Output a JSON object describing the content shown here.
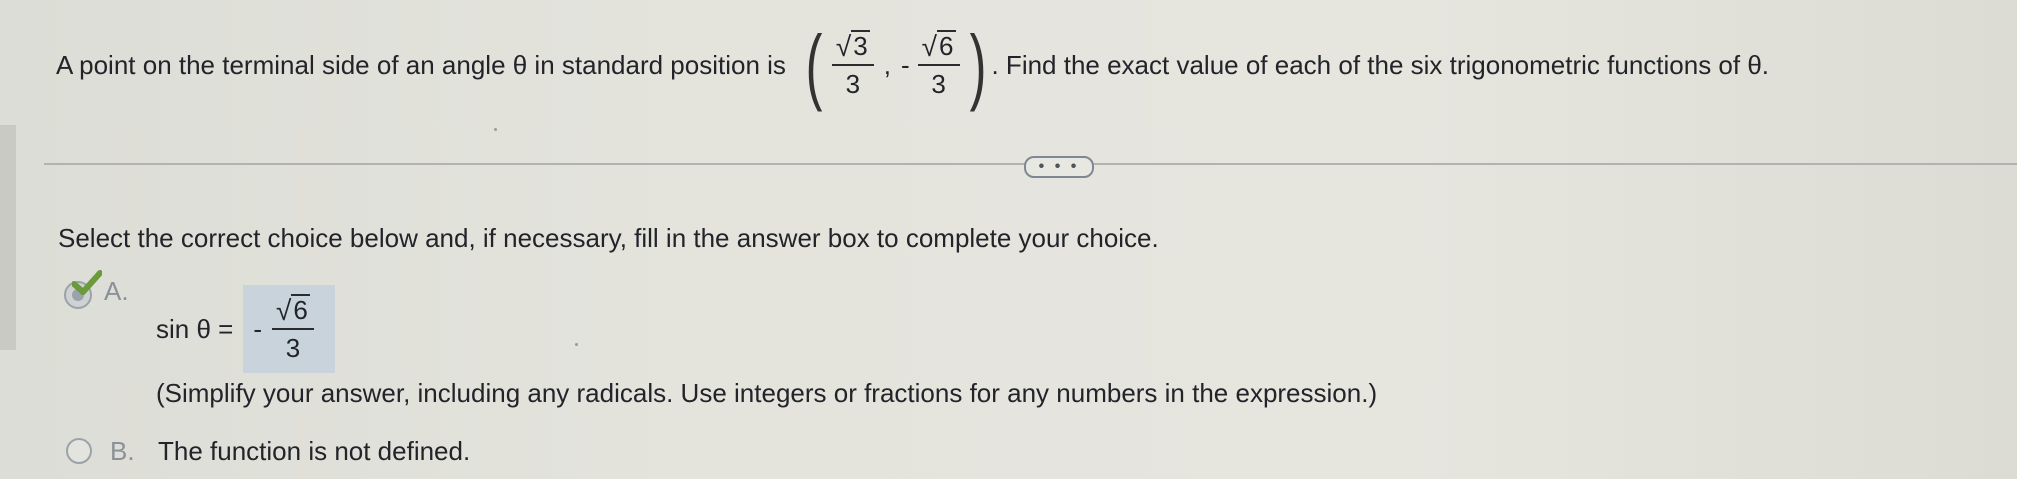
{
  "question": {
    "text_before": "A point on the terminal side of an angle θ in standard position is",
    "point": {
      "x_numerator_radicand": "3",
      "x_denominator": "3",
      "comma": ",",
      "y_sign": "-",
      "y_numerator_radicand": "6",
      "y_denominator": "3"
    },
    "text_after": ". Find the exact value of each of the six trigonometric functions of θ."
  },
  "more_button": {
    "label": "• • •"
  },
  "instruction": "Select the correct choice below and, if necessary, fill in the answer box to complete your choice.",
  "choices": {
    "a": {
      "letter": "A.",
      "selected": true,
      "lhs": "sin θ =",
      "answer": {
        "sign": "-",
        "numerator_radicand": "6",
        "denominator": "3"
      },
      "hint": "(Simplify your answer, including any radicals. Use integers or fractions for any numbers in the expression.)"
    },
    "b": {
      "letter": "B.",
      "selected": false,
      "text": "The function is not defined."
    }
  },
  "colors": {
    "background": "#e4e4dd",
    "answer_box": "#c8d3dc",
    "check": "#6a9a3a"
  },
  "icons": {
    "correct": "check-icon",
    "selected_radio": "radio-selected-icon",
    "unselected_radio": "radio-unselected-icon"
  }
}
